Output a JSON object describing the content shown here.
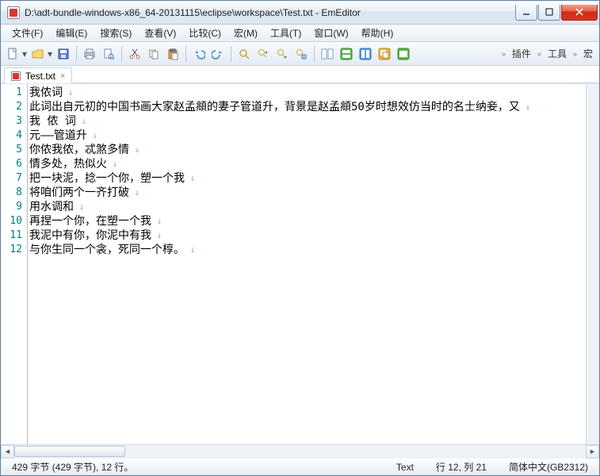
{
  "window": {
    "title": "D:\\adt-bundle-windows-x86_64-20131115\\eclipse\\workspace\\Test.txt - EmEditor"
  },
  "menu": {
    "file": "文件(F)",
    "edit": "编辑(E)",
    "search": "搜索(S)",
    "view": "查看(V)",
    "compare": "比较(C)",
    "macro": "宏(M)",
    "tools": "工具(T)",
    "window": "窗口(W)",
    "help": "帮助(H)"
  },
  "rightToolbar": {
    "plugins": "插件",
    "tools": "工具",
    "macro": "宏"
  },
  "tab": {
    "label": "Test.txt"
  },
  "lines": [
    "我侬词",
    "此词出自元初的中国书画大家赵孟頫的妻子管道升，背景是赵孟頫50岁时想效仿当时的名士纳妾，又",
    "我 侬 词",
    "元——管道升",
    "你侬我侬，忒煞多情",
    "情多处，热似火",
    "把一块泥，捻一个你，塑一个我",
    "将咱们两个一齐打破",
    "用水调和",
    "再捏一个你，在塑一个我",
    "我泥中有你，你泥中有我",
    "与你生同一个衾，死同一个椁。"
  ],
  "status": {
    "left": "429 字节 (429 字节), 12 行。",
    "mode": "Text",
    "pos": "行 12, 列 21",
    "encoding": "简体中文(GB2312)"
  }
}
